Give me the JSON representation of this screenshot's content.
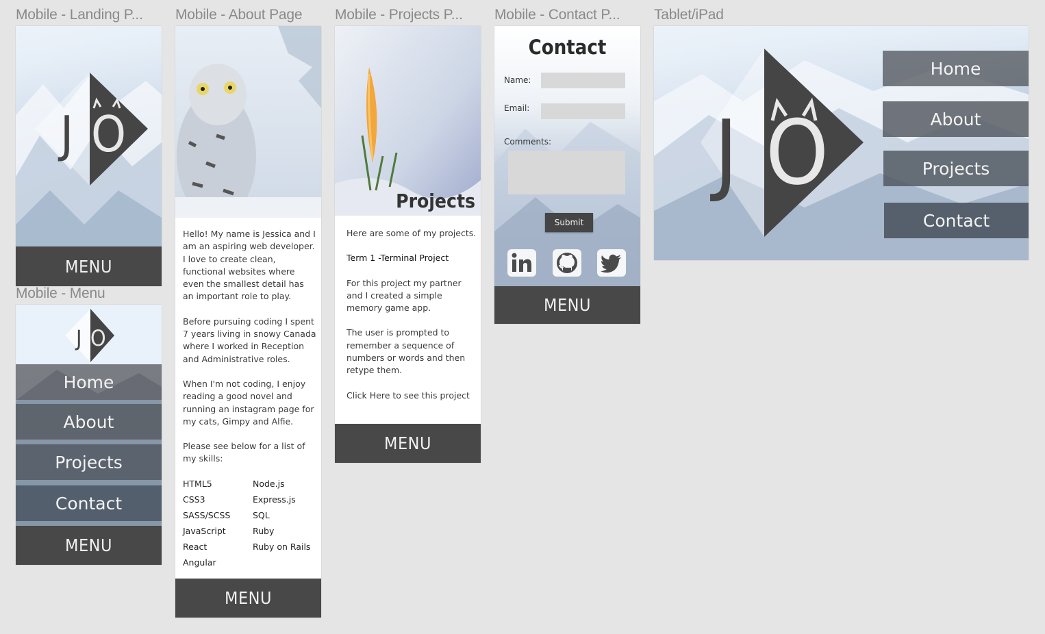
{
  "frames": {
    "landing": "Mobile - Landing P...",
    "about": "Mobile - About Page",
    "projects": "Mobile - Projects P...",
    "contact": "Mobile - Contact P...",
    "tablet": "Tablet/iPad",
    "menu": "Mobile - Menu"
  },
  "logo": {
    "letter1": "J",
    "letter2": "O"
  },
  "menu_label": "MENU",
  "nav": {
    "home": "Home",
    "about": "About",
    "projects": "Projects",
    "contact": "Contact"
  },
  "about": {
    "paragraphs": [
      "Hello! My name is Jessica and I am an aspiring web developer. I love to create clean, functional websites where even the smallest detail has an important role to play.",
      "Before pursuing coding I spent 7 years living in snowy Canada where I worked in Reception and Administrative roles.",
      "When I'm not coding, I enjoy reading a good novel and running an instagram page for my cats, Gimpy and Alfie.",
      "Please see below for a list of my skills:"
    ],
    "skills_left": [
      "HTML5",
      "CSS3",
      "SASS/SCSS",
      "JavaScript",
      "React",
      "Angular"
    ],
    "skills_right": [
      "Node.js",
      "Express.js",
      "SQL",
      "Ruby",
      "Ruby on Rails"
    ]
  },
  "projects": {
    "heading": "Projects",
    "intro": "Here are some of my projects.",
    "project_title": "Term 1 -Terminal Project",
    "desc1": "For this project my partner and I created a simple memory game app.",
    "desc2": "The user is prompted to remember a sequence of numbers or words and then retype them.",
    "link": "Click Here to see this project"
  },
  "contact": {
    "heading": "Contact",
    "name_label": "Name:",
    "email_label": "Email:",
    "comments_label": "Comments:",
    "submit": "Submit",
    "social": [
      "linkedin-icon",
      "github-icon",
      "twitter-icon"
    ]
  },
  "colors": {
    "dark": "#484848",
    "bg": "#e5e5e5",
    "field": "#d8d8d8"
  }
}
